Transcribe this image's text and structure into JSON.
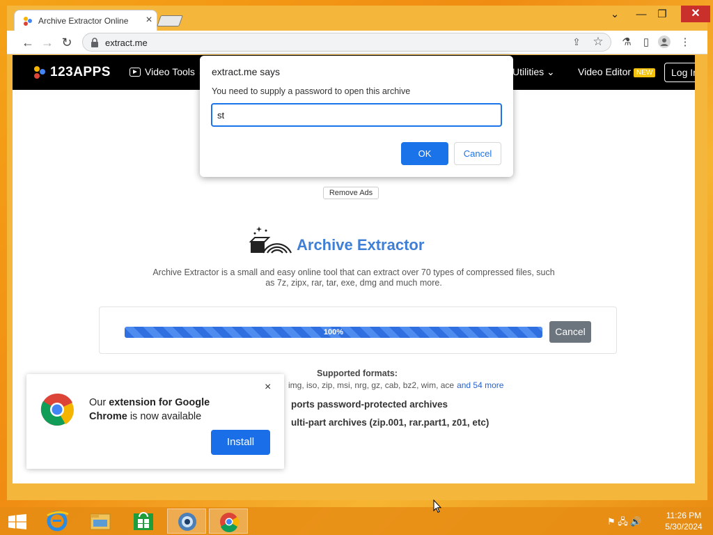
{
  "browser": {
    "tab_title": "Archive Extractor Online",
    "tab_close": "×",
    "url": "extract.me",
    "window_controls": {
      "chevron": "⌄",
      "minimize": "—",
      "maximize": "❐",
      "close": "✕"
    }
  },
  "site_nav": {
    "logo": "123APPS",
    "video_tools": "Video Tools ⌄",
    "utilities": "Utilities ⌄",
    "video_editor": "Video Editor",
    "new_badge": "NEW",
    "login": "Log In"
  },
  "page": {
    "remove_ads": "Remove Ads",
    "app_name": "Archive Extractor",
    "description": "Archive Extractor is a small and easy online tool that can extract over 70 types of compressed files, such as 7z, zipx, rar, tar, exe, dmg and much more.",
    "progress": {
      "value": 1.0,
      "label": "100%"
    },
    "cancel": "Cancel",
    "supported_title": "Supported formats:",
    "formats": "img, iso, zip, msi, nrg, gz, cab, bz2, wim, ace",
    "formats_more": "and 54 more",
    "feature1": "ports password-protected archives",
    "feature2": "ulti-part archives (zip.001, rar.part1, z01, etc)"
  },
  "dialog": {
    "title": "extract.me says",
    "message": "You need to supply a password to open this archive",
    "input_value": "st",
    "ok": "OK",
    "cancel": "Cancel"
  },
  "popup": {
    "text_pre": "Our ",
    "text_bold1": "extension for Google Chrome",
    "text_post": " is now available",
    "close": "×",
    "install": "Install"
  },
  "taskbar": {
    "time": "11:26 PM",
    "date": "5/30/2024",
    "tray": "⚑ 🖧 🔊"
  },
  "colors": {
    "accent": "#1a73e8",
    "brand": "#3f7fd6",
    "progress": "#2f6fe0"
  }
}
